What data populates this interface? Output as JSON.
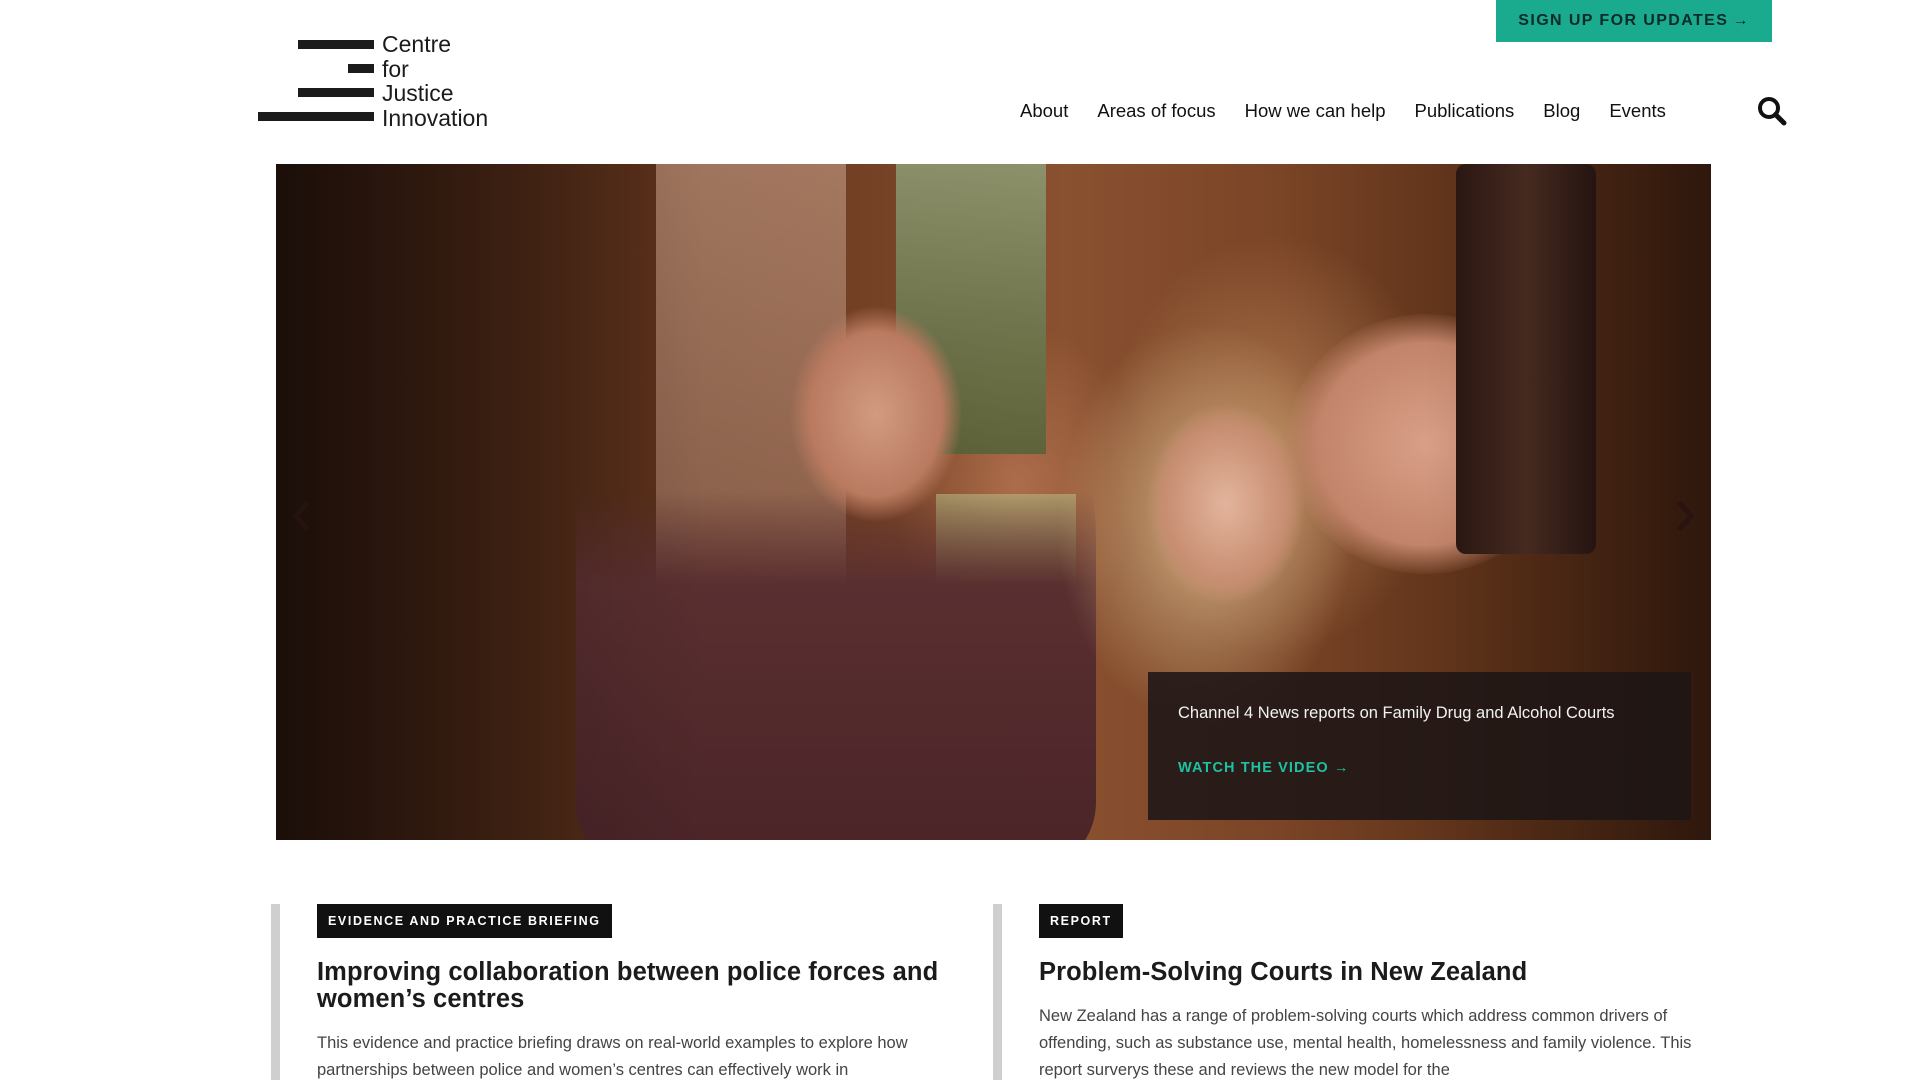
{
  "header": {
    "logo_lines": [
      "Centre",
      "for",
      "Justice",
      "Innovation"
    ],
    "signup_label": "SIGN UP FOR UPDATES",
    "signup_arrow": "→",
    "nav": [
      "About",
      "Areas of focus",
      "How we can help",
      "Publications",
      "Blog",
      "Events"
    ]
  },
  "hero": {
    "caption": "Channel 4 News reports on Family Drug and Alcohol Courts",
    "link_label": "WATCH THE VIDEO",
    "link_arrow": "→"
  },
  "cards": [
    {
      "tag": "EVIDENCE AND PRACTICE BRIEFING",
      "title": "Improving collaboration between police forces and women’s centres",
      "excerpt": "This evidence and practice briefing draws on real-world examples to explore how partnerships between police and women’s centres can effectively work in"
    },
    {
      "tag": "REPORT",
      "title": "Problem-Solving Courts in New Zealand",
      "excerpt": "New Zealand has a range of problem-solving courts which address common drivers of offending, such as substance use, mental health, homelessness and family violence. This report surverys these and reviews the new model for the"
    }
  ],
  "colors": {
    "accent": "#1aab8f",
    "link_accent": "#1fc1a0",
    "tag_bg": "#111111",
    "card_rule": "#cfcfcf"
  },
  "icons": {
    "search": "search-icon",
    "prev": "chevron-left-icon",
    "next": "chevron-right-icon"
  }
}
